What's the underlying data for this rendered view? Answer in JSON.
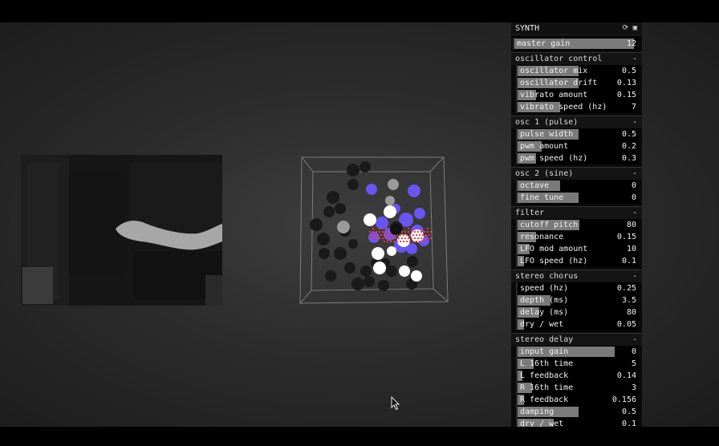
{
  "panel": {
    "title": "SYNTH",
    "icons": [
      "refresh-icon",
      "save-icon"
    ],
    "master": {
      "label": "master gain",
      "value": "12",
      "fill": 0.96
    },
    "groups": [
      {
        "title": "oscillator control",
        "controls": [
          {
            "label": "oscillator mix",
            "value": "0.5",
            "fill": 0.5
          },
          {
            "label": "oscillator drift",
            "value": "0.13",
            "fill": 0.5
          },
          {
            "label": "vibrato amount",
            "value": "0.15",
            "fill": 0.15
          },
          {
            "label": "vibrato speed (hz)",
            "value": "7",
            "fill": 0.35
          }
        ]
      },
      {
        "title": "osc 1 (pulse)",
        "controls": [
          {
            "label": "pulse width",
            "value": "0.5",
            "fill": 0.5
          },
          {
            "label": "pwm amount",
            "value": "0.2",
            "fill": 0.2
          },
          {
            "label": "pwm speed (hz)",
            "value": "0.3",
            "fill": 0.15
          }
        ]
      },
      {
        "title": "osc 2 (sine)",
        "controls": [
          {
            "label": "octave",
            "value": "0",
            "fill": 0.35
          },
          {
            "label": "fine tune",
            "value": "0",
            "fill": 0.5
          }
        ]
      },
      {
        "title": "filter",
        "controls": [
          {
            "label": "cutoff pitch",
            "value": "80",
            "fill": 0.51
          },
          {
            "label": "resonance",
            "value": "0.15",
            "fill": 0.15
          },
          {
            "label": "LFO mod amount",
            "value": "10",
            "fill": 0.1
          },
          {
            "label": "LFO speed (hz)",
            "value": "0.1",
            "fill": 0.05
          }
        ]
      },
      {
        "title": "stereo chorus",
        "controls": [
          {
            "label": "speed (hz)",
            "value": "0.25",
            "fill": 0.0
          },
          {
            "label": "depth (ms)",
            "value": "3.5",
            "fill": 0.27
          },
          {
            "label": "delay (ms)",
            "value": "80",
            "fill": 0.18
          },
          {
            "label": "dry / wet",
            "value": "0.05",
            "fill": 0.05
          }
        ]
      },
      {
        "title": "stereo delay",
        "controls": [
          {
            "label": "input gain",
            "value": "0",
            "fill": 0.8
          },
          {
            "label": "L 16th time",
            "value": "5",
            "fill": 0.13
          },
          {
            "label": "L feedback",
            "value": "0.14",
            "fill": 0.04
          },
          {
            "label": "R 16th time",
            "value": "3",
            "fill": 0.12
          },
          {
            "label": "R feedback",
            "value": "0.156",
            "fill": 0.05
          },
          {
            "label": "damping",
            "value": "0.5",
            "fill": 0.5
          },
          {
            "label": "dry / wet",
            "value": "0.1",
            "fill": 0.3
          }
        ]
      }
    ]
  }
}
